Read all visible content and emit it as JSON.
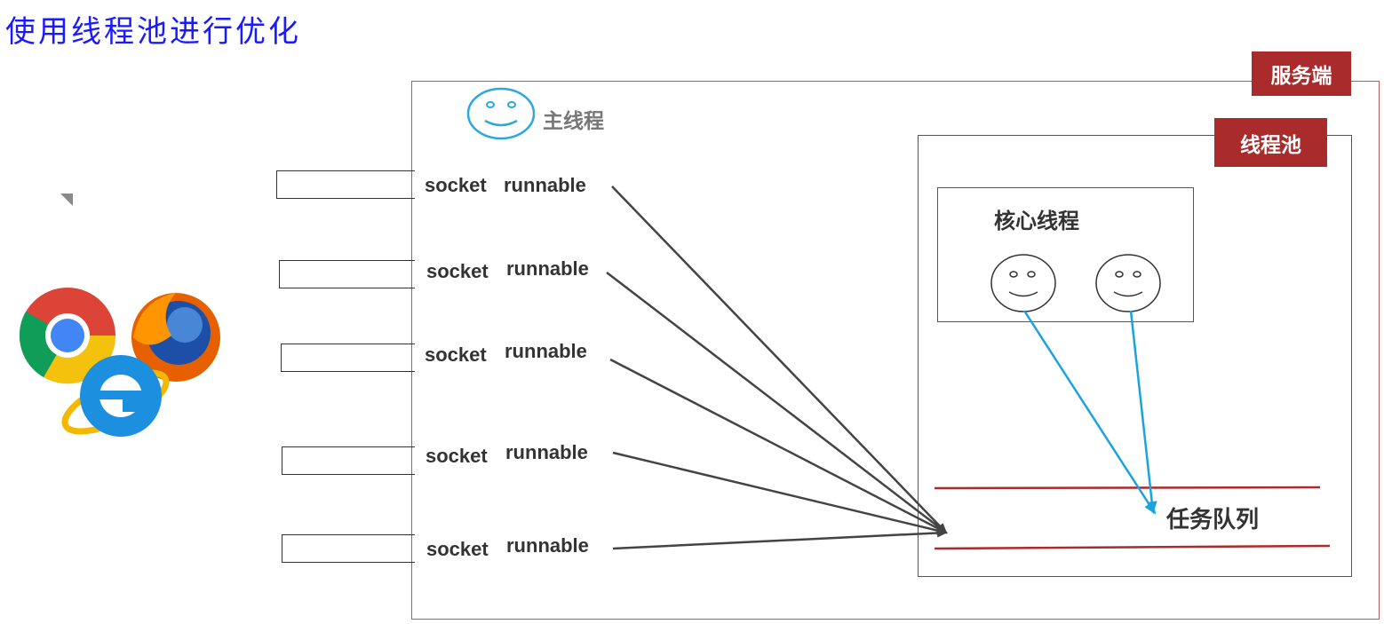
{
  "title": "使用线程池进行优化",
  "server": {
    "label": "服务端"
  },
  "main_thread": {
    "label": "主线程"
  },
  "thread_pool": {
    "label": "线程池"
  },
  "core_threads": {
    "label": "核心线程"
  },
  "task_queue": {
    "label": "任务队列"
  },
  "requests": [
    {
      "socket": "socket",
      "task": "runnable"
    },
    {
      "socket": "socket",
      "task": "runnable"
    },
    {
      "socket": "socket",
      "task": "runnable"
    },
    {
      "socket": "socket",
      "task": "runnable"
    },
    {
      "socket": "socket",
      "task": "runnable"
    }
  ],
  "colors": {
    "title": "#1a1aff",
    "tag_bg": "#a92b2b",
    "main_face": "#29a8e0",
    "thread_arrow": "#1aa3e0",
    "queue_line": "#a92b2b"
  },
  "icons": [
    "chrome-icon",
    "firefox-icon",
    "ie-icon",
    "smiley-icon"
  ]
}
